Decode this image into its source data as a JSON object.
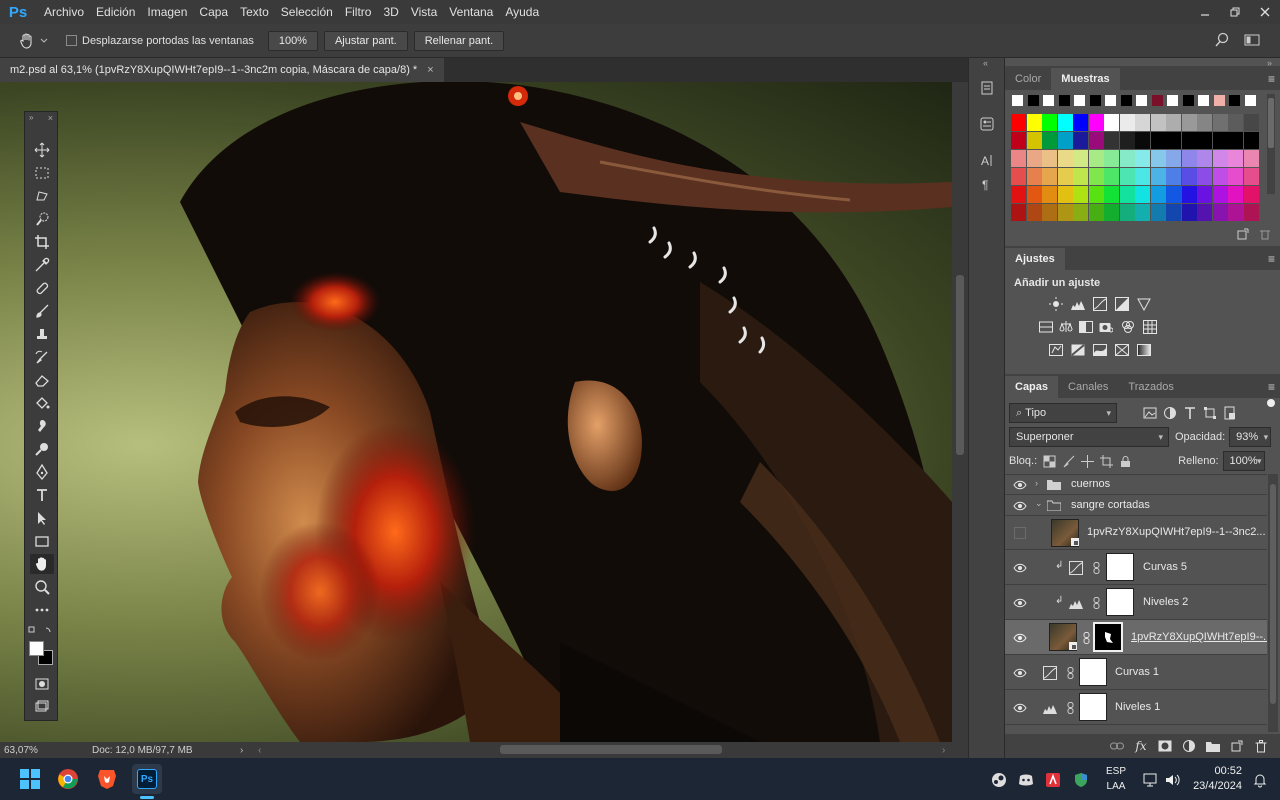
{
  "app": {
    "logo": "Ps"
  },
  "menu": [
    "Archivo",
    "Edición",
    "Imagen",
    "Capa",
    "Texto",
    "Selección",
    "Filtro",
    "3D",
    "Vista",
    "Ventana",
    "Ayuda"
  ],
  "options_bar": {
    "scroll_all_label": "Desplazarse portodas las ventanas",
    "zoom_value": "100%",
    "fit_screen": "Ajustar pant.",
    "fill_screen": "Rellenar pant."
  },
  "document": {
    "tab_title": "m2.psd al 63,1% (1pvRzY8XupQIWHt7epI9--1--3nc2m copia, Máscara de capa/8) *",
    "close": "×"
  },
  "status": {
    "zoom": "63,07%",
    "doc": "Doc: 12,0 MB/97,7 MB"
  },
  "color_panel": {
    "tabs": [
      "Color",
      "Muestras"
    ],
    "active_tab": "Muestras"
  },
  "adjustments_panel": {
    "title": "Ajustes",
    "subtitle": "Añadir un ajuste"
  },
  "layers_panel": {
    "tabs": [
      "Capas",
      "Canales",
      "Trazados"
    ],
    "filter_kind": "Tipo",
    "blend_mode": "Superponer",
    "opacity_label": "Opacidad:",
    "opacity_value": "93%",
    "lock_label": "Bloq.:",
    "fill_label": "Relleno:",
    "fill_value": "100%",
    "layers": [
      {
        "name": "cuernos",
        "kind": "group",
        "visible": true
      },
      {
        "name": "sangre cortadas",
        "kind": "group",
        "visible": true,
        "open": true
      },
      {
        "name": "1pvRzY8XupQIWHt7epI9--1--3nc2...",
        "kind": "smart",
        "visible": false
      },
      {
        "name": "Curvas 5",
        "kind": "curves",
        "visible": true,
        "clipped": true
      },
      {
        "name": "Niveles 2",
        "kind": "levels",
        "visible": true,
        "clipped": true
      },
      {
        "name": "1pvRzY8XupQIWHt7epI9--...",
        "kind": "image-mask",
        "visible": true,
        "selected": true
      },
      {
        "name": "Curvas 1",
        "kind": "curves",
        "visible": true
      },
      {
        "name": "Niveles 1",
        "kind": "levels",
        "visible": true
      }
    ]
  },
  "taskbar": {
    "lang_top": "ESP",
    "lang_bottom": "LAA",
    "time": "00:52",
    "date": "23/4/2024",
    "ps_label": "Ps"
  },
  "colors": {
    "accent": "#31a8ff",
    "panel_bg": "#535353",
    "panel_dark": "#424242",
    "selected_layer": "#6a6a6a"
  }
}
